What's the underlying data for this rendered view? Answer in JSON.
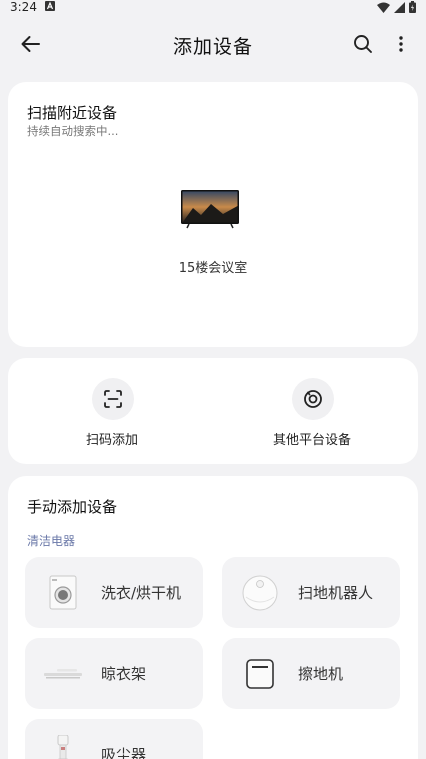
{
  "status_bar": {
    "time": "3:24"
  },
  "header": {
    "title": "添加设备"
  },
  "scan": {
    "title": "扫描附近设备",
    "subtitle": "持续自动搜索中...",
    "devices": [
      {
        "name": "15楼会议室",
        "icon": "tv-icon"
      }
    ]
  },
  "quick_actions": [
    {
      "label": "扫码添加",
      "icon": "scan-qr-icon"
    },
    {
      "label": "其他平台设备",
      "icon": "other-platform-icon"
    }
  ],
  "manual": {
    "title": "手动添加设备",
    "category": "清洁电器",
    "items": [
      {
        "label": "洗衣/烘干机",
        "icon": "washing-machine-icon"
      },
      {
        "label": "扫地机器人",
        "icon": "robot-vacuum-icon"
      },
      {
        "label": "晾衣架",
        "icon": "clothes-rack-icon"
      },
      {
        "label": "擦地机",
        "icon": "floor-scrubber-icon"
      },
      {
        "label": "吸尘器",
        "icon": "vacuum-cleaner-icon"
      }
    ]
  },
  "colors": {
    "background": "#f2f2f4",
    "card": "#ffffff",
    "tile": "#f3f3f5",
    "category_accent": "#6a78a8"
  }
}
